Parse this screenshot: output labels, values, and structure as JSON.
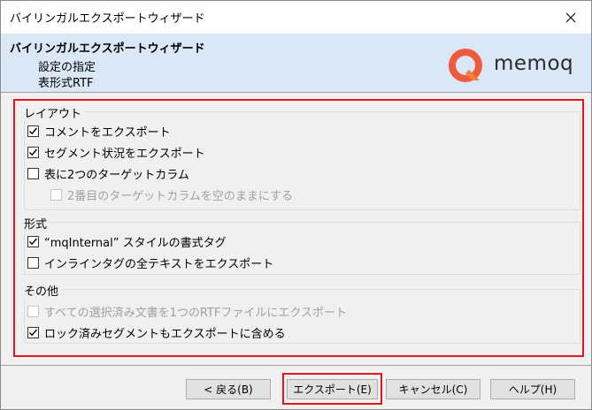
{
  "window": {
    "title": "バイリンガルエクスポートウィザード"
  },
  "header": {
    "title": "バイリンガルエクスポートウィザード",
    "subtitle1": "設定の指定",
    "subtitle2": "表形式RTF",
    "logo_text": "memoq",
    "logo_color": "#ef5a3c"
  },
  "layout_group": {
    "label": "レイアウト",
    "items": [
      {
        "label": "コメントをエクスポート",
        "checked": true,
        "enabled": true
      },
      {
        "label": "セグメント状況をエクスポート",
        "checked": true,
        "enabled": true
      },
      {
        "label": "表に2つのターゲットカラム",
        "checked": false,
        "enabled": true
      },
      {
        "label": "2番目のターゲットカラムを空のままにする",
        "checked": false,
        "enabled": false
      }
    ]
  },
  "format_group": {
    "label": "形式",
    "items": [
      {
        "label": "“mqInternal” スタイルの書式タグ",
        "checked": true,
        "enabled": true
      },
      {
        "label": "インラインタグの全テキストをエクスポート",
        "checked": false,
        "enabled": true
      }
    ]
  },
  "other_group": {
    "label": "その他",
    "items": [
      {
        "label": "すべての選択済み文書を1つのRTFファイルにエクスポート",
        "checked": false,
        "enabled": false
      },
      {
        "label": "ロック済みセグメントもエクスポートに含める",
        "checked": true,
        "enabled": true
      }
    ]
  },
  "buttons": {
    "back": "< 戻る(B)",
    "export": "エクスポート(E)",
    "cancel": "キャンセル(C)",
    "help": "ヘルプ(H)"
  },
  "colors": {
    "highlight": "#e8141c",
    "header_bg": "#dae7f6"
  }
}
